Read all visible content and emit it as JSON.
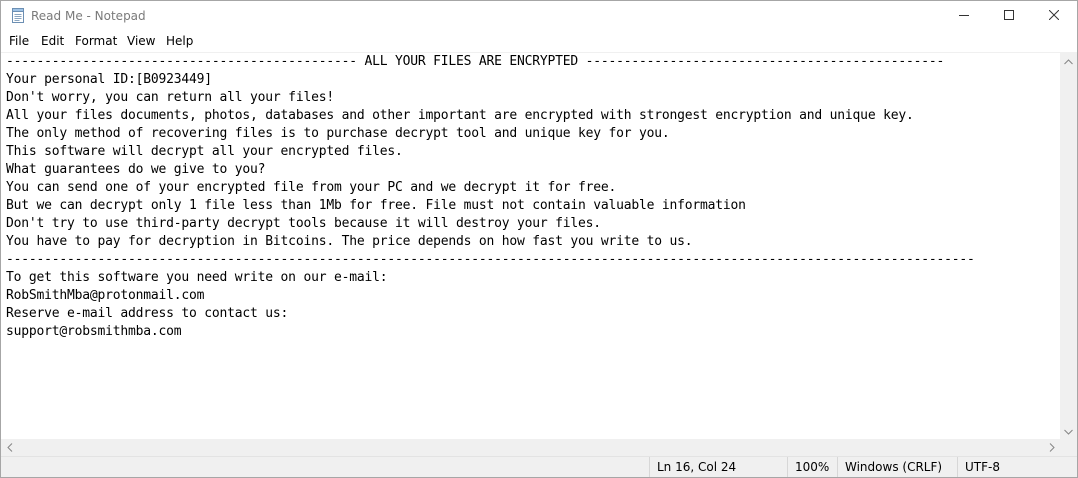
{
  "window": {
    "title": "Read Me - Notepad"
  },
  "menu": [
    "File",
    "Edit",
    "Format",
    "View",
    "Help"
  ],
  "content": {
    "lines": [
      "---------------------------------------------- ALL YOUR FILES ARE ENCRYPTED -----------------------------------------------",
      "Your personal ID:[B0923449]",
      "Don't worry, you can return all your files!",
      "All your files documents, photos, databases and other important are encrypted with strongest encryption and unique key.",
      "The only method of recovering files is to purchase decrypt tool and unique key for you.",
      "This software will decrypt all your encrypted files.",
      "What guarantees do we give to you?",
      "You can send one of your encrypted file from your PC and we decrypt it for free.",
      "But we can decrypt only 1 file less than 1Mb for free. File must not contain valuable information",
      "Don't try to use third-party decrypt tools because it will destroy your files.",
      "You have to pay for decryption in Bitcoins. The price depends on how fast you write to us.",
      "-------------------------------------------------------------------------------------------------------------------------------",
      "To get this software you need write on our e-mail:",
      "RobSmithMba@protonmail.com",
      "Reserve e-mail address to contact us:",
      "support@robsmithmba.com"
    ]
  },
  "status": {
    "position": "Ln 16, Col 24",
    "zoom": "100%",
    "line_ending": "Windows (CRLF)",
    "encoding": "UTF-8"
  },
  "icons": {
    "app": "notepad-icon",
    "minimize": "minimize-icon",
    "maximize": "maximize-icon",
    "close": "close-icon"
  }
}
